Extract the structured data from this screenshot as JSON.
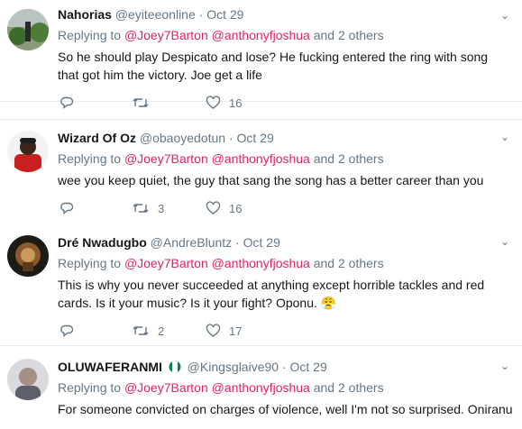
{
  "tweets": [
    {
      "name": "Nahorias",
      "handle": "@eyiteeonline",
      "time": "Oct 29",
      "reply_prefix": "Replying to",
      "mention1": "@Joey7Barton",
      "mention2": "@anthonyfjoshua",
      "others": "and 2 others",
      "text_line1": "So he should play Despicato and lose? He fucking entered the ring with song",
      "text_line2": "that got him the victory. Joe get a life",
      "replies": "",
      "retweets": "",
      "likes": "16"
    },
    {
      "name": "Wizard Of Oz",
      "handle": "@obaoyedotun",
      "time": "Oct 29",
      "reply_prefix": "Replying to",
      "mention1": "@Joey7Barton",
      "mention2": "@anthonyfjoshua",
      "others": "and 2 others",
      "text_line1": "wee you keep quiet, the guy that sang the song has a better career than you",
      "replies": "",
      "retweets": "3",
      "likes": "16"
    },
    {
      "name": "Dré Nwadugbo",
      "handle": "@AndreBluntz",
      "time": "Oct 29",
      "reply_prefix": "Replying to",
      "mention1": "@Joey7Barton",
      "mention2": "@anthonyfjoshua",
      "others": "and 2 others",
      "text_line1": "This is why you never succeeded at anything except horrible tackles and red",
      "text_line2": "cards. Is it your music? Is it your fight? Oponu.",
      "emoji": "😤",
      "replies": "",
      "retweets": "2",
      "likes": "17"
    },
    {
      "name": "OLUWAFERANMI",
      "handle": "@Kingsglaive90",
      "time": "Oct 29",
      "reply_prefix": "Replying to",
      "mention1": "@Joey7Barton",
      "mention2": "@anthonyfjoshua",
      "others": "and 2 others",
      "text_line1": "For someone convicted on charges of violence, well I'm not so surprised. Oniranu"
    }
  ],
  "separator": "·",
  "icons": {
    "more": "chevron-down-icon",
    "reply": "reply-icon",
    "retweet": "retweet-icon",
    "like": "heart-icon",
    "flag": "nigeria-flag-icon"
  },
  "colors": {
    "mention": "#e0245e",
    "secondary": "#657786",
    "divider": "#e6ecf0"
  }
}
